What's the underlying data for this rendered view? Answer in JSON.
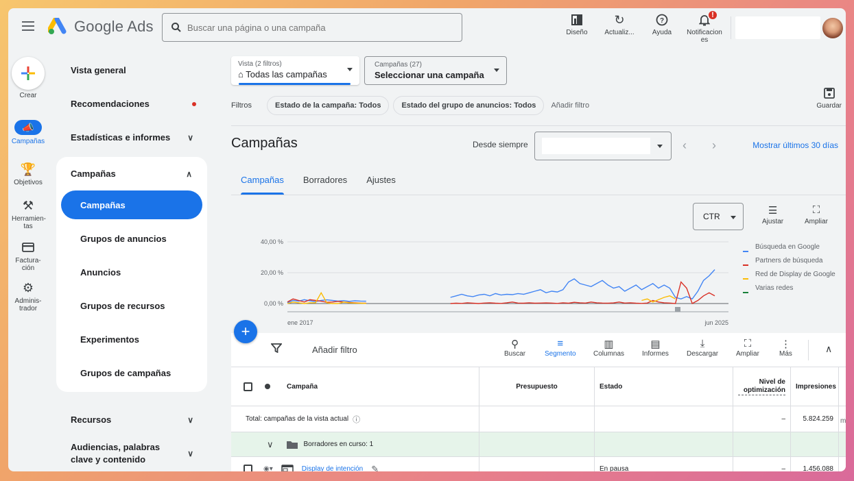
{
  "app": {
    "name": "Google Ads",
    "search_placeholder": "Buscar una página o una campaña"
  },
  "top_actions": [
    {
      "label": "Diseño",
      "icon": "layout-icon"
    },
    {
      "label": "Actualiz...",
      "icon": "refresh-icon"
    },
    {
      "label": "Ayuda",
      "icon": "help-icon"
    },
    {
      "label": "Notificacion es",
      "icon": "bell-icon",
      "badge": "!"
    }
  ],
  "rail": {
    "create": "Crear",
    "items": [
      {
        "label": "Campañas",
        "icon": "megaphone-icon"
      },
      {
        "label": "Objetivos",
        "icon": "trophy-icon"
      },
      {
        "label": "Herramien-tas",
        "icon": "tools-icon"
      },
      {
        "label": "Factura-ción",
        "icon": "billing-icon"
      },
      {
        "label": "Adminis-trador",
        "icon": "settings-icon"
      }
    ]
  },
  "nav": {
    "vista_general": "Vista general",
    "recomendaciones": "Recomendaciones",
    "estadisticas": "Estadísticas e informes",
    "campanas_group": "Campañas",
    "sub": [
      "Campañas",
      "Grupos de anuncios",
      "Anuncios",
      "Grupos de recursos",
      "Experimentos",
      "Grupos de campañas"
    ],
    "recursos": "Recursos",
    "audiencias": "Audiencias, palabras clave y contenido"
  },
  "view": {
    "vista_small": "Vista (2 filtros)",
    "vista_big": "Todas las campañas",
    "camp_small": "Campañas (27)",
    "camp_big": "Seleccionar una campaña"
  },
  "filters": {
    "label": "Filtros",
    "chips": [
      "Estado de la campaña: Todos",
      "Estado del grupo de anuncios: Todos"
    ],
    "add": "Añadir filtro",
    "save": "Guardar"
  },
  "page": {
    "title": "Campañas",
    "desde": "Desde siempre",
    "mostrar": "Mostrar últimos 30 días",
    "tabs": [
      "Campañas",
      "Borradores",
      "Ajustes"
    ]
  },
  "chart_controls": {
    "metric": "CTR",
    "ajustar": "Ajustar",
    "ampliar": "Ampliar"
  },
  "chart_data": {
    "type": "line",
    "y_ticks": [
      "40,00 %",
      "20,00 %",
      "0,00 %"
    ],
    "ylim": [
      0,
      40
    ],
    "x_start": "ene 2017",
    "x_end": "jun 2025",
    "series": [
      {
        "name": "Búsqueda en Google",
        "color": "#4285f4",
        "values": [
          0.5,
          2,
          1.5,
          2.5,
          1.8,
          1.2,
          2,
          2.4,
          2,
          1.6,
          1.9,
          1.4,
          1.8,
          1.6,
          1.5,
          null,
          null,
          null,
          null,
          null,
          null,
          null,
          null,
          null,
          null,
          null,
          null,
          null,
          null,
          4,
          5,
          6,
          5,
          4.5,
          5.5,
          6,
          5,
          6.5,
          5.5,
          6,
          5.8,
          6.5,
          6,
          7,
          8,
          9,
          7,
          8,
          7.5,
          9,
          14,
          16,
          13,
          12,
          11,
          13,
          15,
          12,
          10,
          11,
          8,
          10,
          12,
          9,
          11,
          13,
          10,
          12,
          10,
          4,
          3,
          4.5,
          3,
          8,
          15,
          18,
          22
        ]
      },
      {
        "name": "Partners de búsqueda",
        "color": "#d93025",
        "values": [
          1,
          3,
          2,
          1,
          2.5,
          2,
          1.5,
          0.8,
          1,
          1.4,
          1,
          0.7,
          0.5,
          0.3,
          0.2,
          null,
          null,
          null,
          null,
          null,
          null,
          null,
          null,
          null,
          null,
          null,
          null,
          null,
          null,
          0,
          0.2,
          0.1,
          0.5,
          0.2,
          0,
          0.3,
          0.5,
          0.2,
          0.1,
          0.5,
          1,
          0.3,
          0.2,
          0.5,
          0.2,
          0.3,
          0.4,
          0.3,
          0.1,
          0.5,
          0.2,
          0.8,
          0.5,
          0.3,
          1,
          0.5,
          0.3,
          0.2,
          0.4,
          1,
          0.3,
          0.5,
          0.2,
          0.1,
          0.3,
          2,
          1,
          0.5,
          0.3,
          0,
          14,
          10,
          0,
          2,
          5,
          7,
          5
        ]
      },
      {
        "name": "Red de Display de Google",
        "color": "#fbbc04",
        "values": [
          0,
          1,
          0.5,
          0,
          0.5,
          0.5,
          7,
          0.5,
          0,
          0,
          1,
          0.5,
          0.3,
          0.2,
          0.1,
          null,
          null,
          null,
          null,
          null,
          null,
          null,
          null,
          null,
          null,
          null,
          null,
          null,
          null,
          null,
          null,
          null,
          null,
          null,
          null,
          null,
          null,
          null,
          null,
          null,
          null,
          null,
          null,
          null,
          null,
          null,
          null,
          null,
          null,
          null,
          null,
          null,
          null,
          null,
          null,
          null,
          null,
          null,
          null,
          null,
          null,
          null,
          null,
          2,
          3,
          1,
          2.5,
          4,
          5,
          3,
          null,
          null,
          null,
          null,
          null,
          null,
          null
        ]
      },
      {
        "name": "Varias redes",
        "color": "#188038",
        "values": []
      }
    ]
  },
  "table": {
    "toolbar": {
      "add_filter": "Añadir filtro",
      "actions": [
        "Buscar",
        "Segmento",
        "Columnas",
        "Informes",
        "Descargar",
        "Ampliar",
        "Más"
      ]
    },
    "headers": {
      "campana": "Campaña",
      "presupuesto": "Presupuesto",
      "estado": "Estado",
      "nivel": "Nivel de optimización",
      "impresiones": "Impresiones"
    },
    "total_row": {
      "label": "Total: campañas de la vista actual",
      "nivel": "–",
      "impresiones": "5.824.259"
    },
    "draft_row": {
      "label": "Borradores en curso: 1"
    },
    "campaign_row": {
      "name": "Display de intención",
      "estado": "En pausa",
      "nivel": "–",
      "impresiones": "1.456.088"
    },
    "overflow_char": "m"
  }
}
